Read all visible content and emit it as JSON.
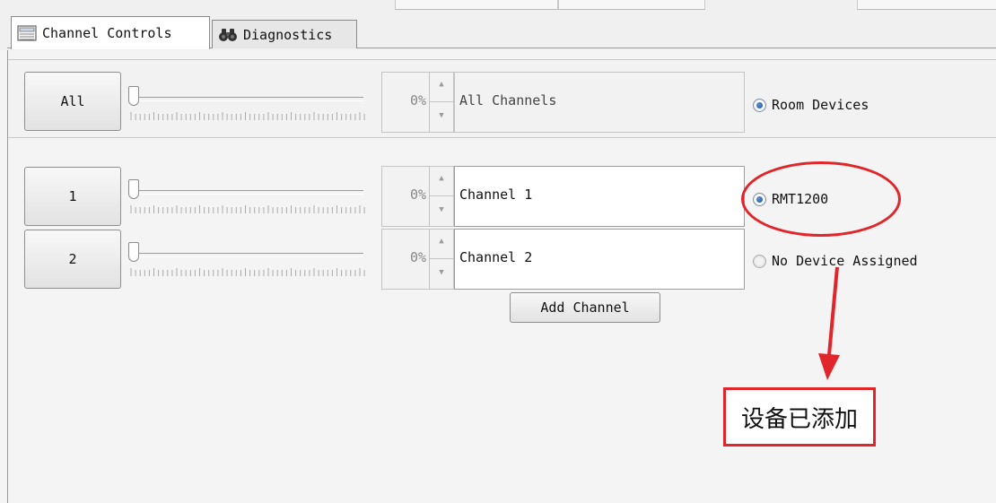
{
  "tabs": [
    {
      "label": "Channel Controls",
      "icon": "panel-icon",
      "active": true
    },
    {
      "label": "Diagnostics",
      "icon": "binoculars-icon",
      "active": false
    }
  ],
  "all_row": {
    "button_label": "All",
    "percent": "0%",
    "name": "All Channels",
    "radio_label": "Room Devices",
    "radio_selected": true
  },
  "channels": [
    {
      "button_label": "1",
      "percent": "0%",
      "name": "Channel 1",
      "device_label": "RMT1200",
      "device_selected": true
    },
    {
      "button_label": "2",
      "percent": "0%",
      "name": "Channel 2",
      "device_label": "No Device Assigned",
      "device_selected": false
    }
  ],
  "add_channel_label": "Add Channel",
  "annotation": {
    "text": "设备已添加",
    "color": "#e0262a"
  }
}
